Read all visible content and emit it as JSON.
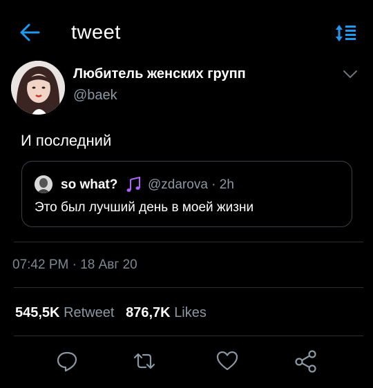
{
  "header": {
    "title": "tweet"
  },
  "author": {
    "name": "Любитель женских групп",
    "handle": "@baek"
  },
  "tweet": {
    "text": "И последний"
  },
  "quote": {
    "name": "so what?",
    "meta": "@zdarova · 2h",
    "text": "Это был лучший день в моей жизни"
  },
  "timestamp": "07:42 PM · 18 Авг 20",
  "stats": {
    "retweets_count": "545,5K",
    "retweets_label": "Retweet",
    "likes_count": "876,7K",
    "likes_label": "Likes"
  },
  "colors": {
    "background": "#000000",
    "accent": "#1d9bf0",
    "secondary_text": "#8b98a5",
    "divider": "#2a2f34",
    "notes": "#b061ff"
  },
  "icons": {
    "back": "arrow-left-icon",
    "sort": "sort-icon",
    "more": "chevron-down-icon",
    "reply": "reply-icon",
    "retweet": "retweet-icon",
    "like": "heart-icon",
    "share": "share-icon",
    "music": "music-notes-icon"
  }
}
